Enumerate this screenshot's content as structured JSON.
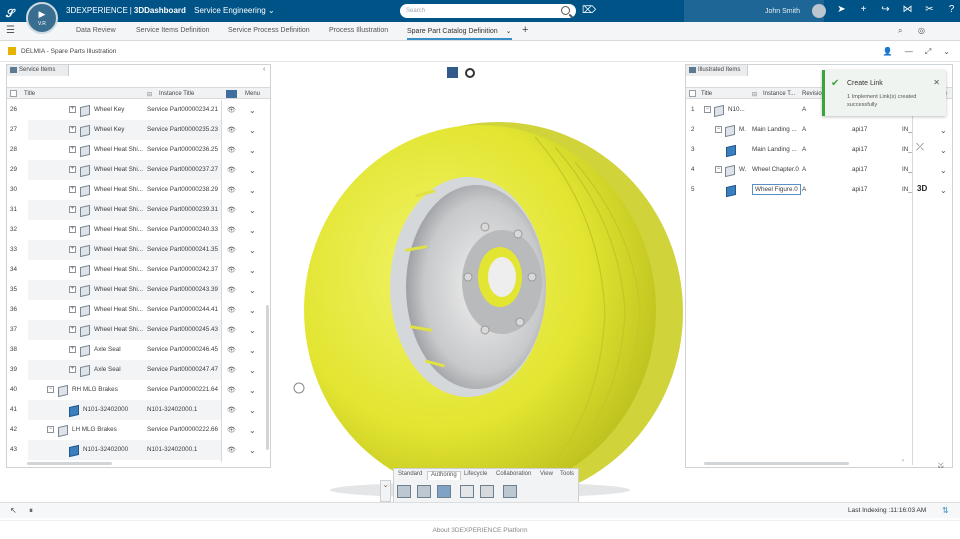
{
  "topbar": {
    "brand_name": "3DEXPERIENCE",
    "app_name": "3DDashboard",
    "context": "Service Engineering",
    "search_placeholder": "Search",
    "user_name": "John Smith",
    "logo_version": "V.R",
    "logo_mark": "3D"
  },
  "tabs": [
    {
      "label": "Data Review"
    },
    {
      "label": "Service Items Definition"
    },
    {
      "label": "Service Process Definition"
    },
    {
      "label": "Process Illustration"
    },
    {
      "label": "Spare Part Catalog Definition"
    }
  ],
  "app": {
    "title": "DELMIA - Spare Parts Illustration"
  },
  "left_panel": {
    "tab_label": "Service Items",
    "headers": {
      "title": "Title",
      "instance_title": "Instance Title",
      "menu": "Menu"
    },
    "rows": [
      {
        "n": "26",
        "title": "Wheel Key",
        "inst": "Service Part00000234.21",
        "level": 2,
        "icon": "grey"
      },
      {
        "n": "27",
        "title": "Wheel Key",
        "inst": "Service Part00000235.23",
        "level": 2,
        "icon": "grey"
      },
      {
        "n": "28",
        "title": "Wheel Heat Shi...",
        "inst": "Service Part00000236.25",
        "level": 2,
        "icon": "grey"
      },
      {
        "n": "29",
        "title": "Wheel Heat Shi...",
        "inst": "Service Part00000237.27",
        "level": 2,
        "icon": "grey"
      },
      {
        "n": "30",
        "title": "Wheel Heat Shi...",
        "inst": "Service Part00000238.29",
        "level": 2,
        "icon": "grey"
      },
      {
        "n": "31",
        "title": "Wheel Heat Shi...",
        "inst": "Service Part00000239.31",
        "level": 2,
        "icon": "grey"
      },
      {
        "n": "32",
        "title": "Wheel Heat Shi...",
        "inst": "Service Part00000240.33",
        "level": 2,
        "icon": "grey"
      },
      {
        "n": "33",
        "title": "Wheel Heat Shi...",
        "inst": "Service Part00000241.35",
        "level": 2,
        "icon": "grey"
      },
      {
        "n": "34",
        "title": "Wheel Heat Shi...",
        "inst": "Service Part00000242.37",
        "level": 2,
        "icon": "grey"
      },
      {
        "n": "35",
        "title": "Wheel Heat Shi...",
        "inst": "Service Part00000243.39",
        "level": 2,
        "icon": "grey"
      },
      {
        "n": "36",
        "title": "Wheel Heat Shi...",
        "inst": "Service Part00000244.41",
        "level": 2,
        "icon": "grey"
      },
      {
        "n": "37",
        "title": "Wheel Heat Shi...",
        "inst": "Service Part00000245.43",
        "level": 2,
        "icon": "grey"
      },
      {
        "n": "38",
        "title": "Axle Seal",
        "inst": "Service Part00000246.45",
        "level": 2,
        "icon": "grey"
      },
      {
        "n": "39",
        "title": "Axle Seal",
        "inst": "Service Part00000247.47",
        "level": 2,
        "icon": "grey"
      },
      {
        "n": "40",
        "title": "RH MLG Brakes",
        "inst": "Service Part00000221.64",
        "level": 1,
        "icon": "grey"
      },
      {
        "n": "41",
        "title": "N101-32402000",
        "inst": "N101-32402000.1",
        "level": 3,
        "icon": "blue"
      },
      {
        "n": "42",
        "title": "LH MLG Brakes",
        "inst": "Service Part00000222.66",
        "level": 1,
        "icon": "grey"
      },
      {
        "n": "43",
        "title": "N101-32402000",
        "inst": "N101-32402000.1",
        "level": 3,
        "icon": "blue"
      }
    ]
  },
  "right_panel": {
    "tab_label": "Illustrated Items",
    "headers": {
      "title": "Title",
      "instance_title": "Instance T...",
      "revision": "Revisio",
      "menu": "nu"
    },
    "rows": [
      {
        "n": "1",
        "title": "N10...",
        "inst": "",
        "rev": "A",
        "c4": "",
        "c5": ""
      },
      {
        "n": "2",
        "title": "M.",
        "inst": "Main Landing ...",
        "rev": "A",
        "c4": "api17",
        "c5": "IN_"
      },
      {
        "n": "3",
        "title": "",
        "inst": "Main Landing ...",
        "rev": "A",
        "c4": "api17",
        "c5": "IN_"
      },
      {
        "n": "4",
        "title": "W.",
        "inst": "Wheel Chapter.0",
        "rev": "A",
        "c4": "api17",
        "c5": "IN_"
      },
      {
        "n": "5",
        "title": "",
        "inst": "Wheel Figure.0",
        "rev": "A",
        "c4": "api17",
        "c5": "IN_"
      }
    ],
    "badge_3d": "3D"
  },
  "toast": {
    "title": "Create Link",
    "message": "1 Implement Link(s) created successfully"
  },
  "toolbar": {
    "tabs": [
      "Standard",
      "Authoring",
      "Lifecycle",
      "Collaboration",
      "View",
      "Tools"
    ],
    "active_tab": "Authoring"
  },
  "status": {
    "indexing": "Last Indexing :11:16:03 AM"
  },
  "footer": {
    "text": "About 3DEXPERIENCE Platform"
  },
  "colors": {
    "topbar": "#005386",
    "tire": "#e6e83a",
    "accent": "#368ec4",
    "success": "#3aa53d"
  }
}
